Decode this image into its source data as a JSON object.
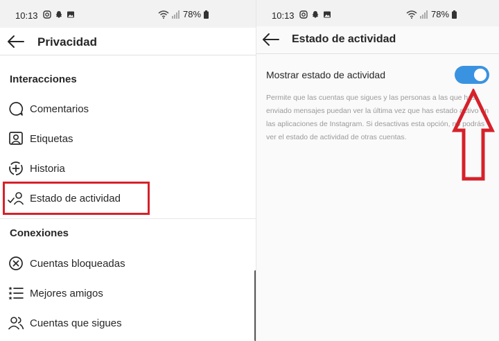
{
  "status_bar": {
    "time": "10:13",
    "battery": "78%"
  },
  "left": {
    "header": {
      "title": "Privacidad"
    },
    "sections": [
      {
        "title": "Interacciones"
      },
      {
        "title": "Conexiones"
      }
    ],
    "items": [
      {
        "label": "Comentarios",
        "icon": "comment-icon"
      },
      {
        "label": "Etiquetas",
        "icon": "tag-person-icon"
      },
      {
        "label": "Historia",
        "icon": "story-plus-icon"
      },
      {
        "label": "Estado de actividad",
        "icon": "activity-status-icon"
      },
      {
        "label": "Cuentas bloqueadas",
        "icon": "blocked-icon"
      },
      {
        "label": "Mejores amigos",
        "icon": "close-friends-list-icon"
      },
      {
        "label": "Cuentas que sigues",
        "icon": "following-people-icon"
      }
    ]
  },
  "right": {
    "header": {
      "title": "Estado de actividad"
    },
    "setting": {
      "label": "Mostrar estado de actividad",
      "enabled": true,
      "description": "Permite que las cuentas que sigues y las personas a las que has enviado mensajes puedan ver la última vez que has estado activo en las aplicaciones de Instagram. Si desactivas esta opción, no podrás ver el estado de actividad de otras cuentas."
    }
  },
  "colors": {
    "toggle_on": "#3a93e1",
    "highlight": "#d6212a",
    "arrow": "#d6212a",
    "description_text": "#9a9a9a"
  }
}
